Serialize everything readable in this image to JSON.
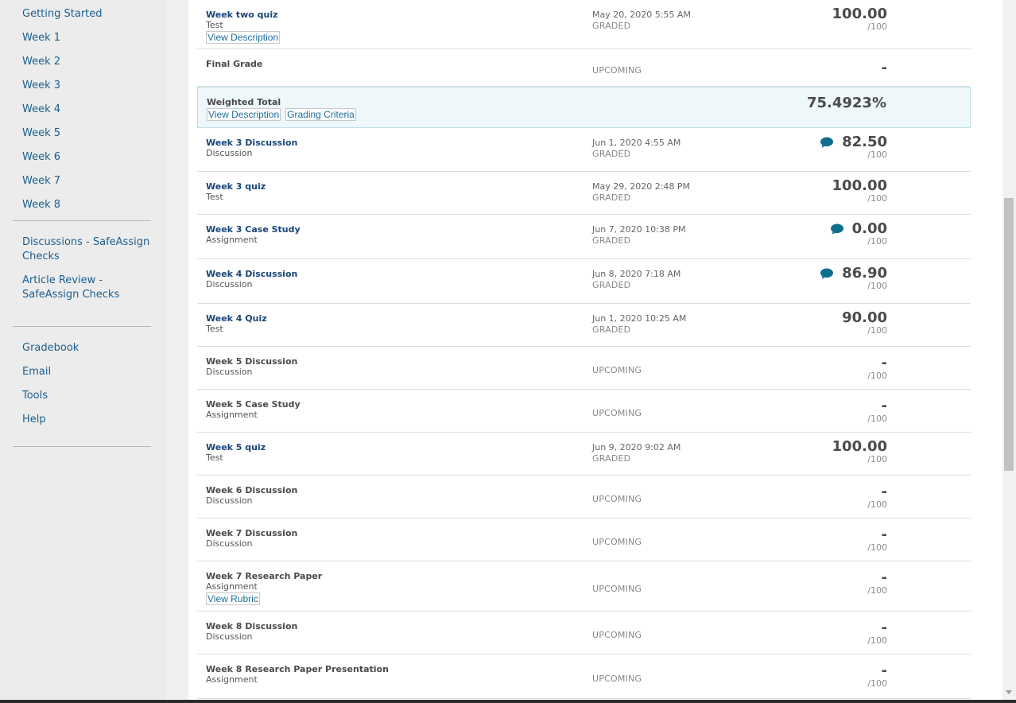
{
  "sidebar": {
    "weeks": [
      "Getting Started",
      "Week 1",
      "Week 2",
      "Week 3",
      "Week 4",
      "Week 5",
      "Week 6",
      "Week 7",
      "Week 8"
    ],
    "checks": [
      "Discussions - SafeAssign Checks",
      "Article Review - SafeAssign Checks"
    ],
    "tools": [
      "Gradebook",
      "Email",
      "Tools",
      "Help"
    ]
  },
  "grades": [
    {
      "title": "Week two quiz",
      "type": "Test",
      "link": true,
      "buttons": [
        "View Description"
      ],
      "date": "May 20, 2020 5:55 AM",
      "status": "GRADED",
      "grade": "100.00",
      "outof": "/100",
      "comment": false
    },
    {
      "title": "Final Grade",
      "type": "",
      "link": false,
      "buttons": [],
      "date": "",
      "status": "UPCOMING",
      "grade": "-",
      "outof": "",
      "comment": false
    },
    {
      "title": "Weighted Total",
      "type": "",
      "link": false,
      "highlight": true,
      "buttons": [
        "View Description",
        "Grading Criteria"
      ],
      "date": "",
      "status": "",
      "grade": "75.4923%",
      "outof": "",
      "comment": false
    },
    {
      "title": "Week 3 Discussion",
      "type": "Discussion",
      "link": true,
      "buttons": [],
      "date": "Jun 1, 2020 4:55 AM",
      "status": "GRADED",
      "grade": "82.50",
      "outof": "/100",
      "comment": true
    },
    {
      "title": "Week 3 quiz",
      "type": "Test",
      "link": true,
      "buttons": [],
      "date": "May 29, 2020 2:48 PM",
      "status": "GRADED",
      "grade": "100.00",
      "outof": "/100",
      "comment": false
    },
    {
      "title": "Week 3 Case Study",
      "type": "Assignment",
      "link": true,
      "buttons": [],
      "date": "Jun 7, 2020 10:38 PM",
      "status": "GRADED",
      "grade": "0.00",
      "outof": "/100",
      "comment": true
    },
    {
      "title": "Week 4 Discussion",
      "type": "Discussion",
      "link": true,
      "buttons": [],
      "date": "Jun 8, 2020 7:18 AM",
      "status": "GRADED",
      "grade": "86.90",
      "outof": "/100",
      "comment": true
    },
    {
      "title": "Week 4 Quiz",
      "type": "Test",
      "link": true,
      "buttons": [],
      "date": "Jun 1, 2020 10:25 AM",
      "status": "GRADED",
      "grade": "90.00",
      "outof": "/100",
      "comment": false
    },
    {
      "title": "Week 5 Discussion",
      "type": "Discussion",
      "link": false,
      "buttons": [],
      "date": "",
      "status": "UPCOMING",
      "grade": "-",
      "outof": "/100",
      "comment": false
    },
    {
      "title": "Week 5 Case Study",
      "type": "Assignment",
      "link": false,
      "buttons": [],
      "date": "",
      "status": "UPCOMING",
      "grade": "-",
      "outof": "/100",
      "comment": false
    },
    {
      "title": "Week 5 quiz",
      "type": "Test",
      "link": true,
      "buttons": [],
      "date": "Jun 9, 2020 9:02 AM",
      "status": "GRADED",
      "grade": "100.00",
      "outof": "/100",
      "comment": false
    },
    {
      "title": "Week 6 Discussion",
      "type": "Discussion",
      "link": false,
      "buttons": [],
      "date": "",
      "status": "UPCOMING",
      "grade": "-",
      "outof": "/100",
      "comment": false
    },
    {
      "title": "Week 7 Discussion",
      "type": "Discussion",
      "link": false,
      "buttons": [],
      "date": "",
      "status": "UPCOMING",
      "grade": "-",
      "outof": "/100",
      "comment": false
    },
    {
      "title": "Week 7 Research Paper",
      "type": "Assignment",
      "link": false,
      "buttons": [
        "View Rubric"
      ],
      "date": "",
      "status": "UPCOMING",
      "grade": "-",
      "outof": "/100",
      "comment": false
    },
    {
      "title": "Week 8 Discussion",
      "type": "Discussion",
      "link": false,
      "buttons": [],
      "date": "",
      "status": "UPCOMING",
      "grade": "-",
      "outof": "/100",
      "comment": false
    },
    {
      "title": "Week 8 Research Paper Presentation",
      "type": "Assignment",
      "link": false,
      "buttons": [],
      "date": "",
      "status": "UPCOMING",
      "grade": "-",
      "outof": "/100",
      "comment": false
    }
  ],
  "colors": {
    "link": "#18457a",
    "nav": "#1b5f8f",
    "comment_icon": "#0f6f8c",
    "highlight_bg": "#eef7fa"
  }
}
